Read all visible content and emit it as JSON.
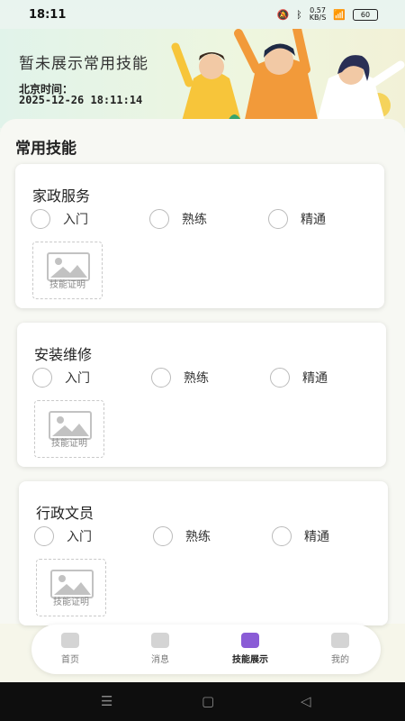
{
  "status_bar": {
    "time": "18:11",
    "net_speed_value": "0.57",
    "net_speed_unit": "KB/S",
    "battery": "60"
  },
  "header": {
    "title": "暂未展示常用技能",
    "time_label": "北京时间：",
    "time_value": "2025-12-26 18:11:14"
  },
  "section_title": "常用技能",
  "skill_levels": [
    "入门",
    "熟练",
    "精通"
  ],
  "cards": [
    {
      "title": "家政服务",
      "cert_label": "技能证明"
    },
    {
      "title": "安装维修",
      "cert_label": "技能证明"
    },
    {
      "title": "行政文员",
      "cert_label": "技能证明"
    }
  ],
  "bottom_nav": [
    {
      "label": "首页",
      "icon": "home-icon",
      "active": false
    },
    {
      "label": "消息",
      "icon": "message-icon",
      "active": false
    },
    {
      "label": "技能展示",
      "icon": "skills-icon",
      "active": true
    },
    {
      "label": "我的",
      "icon": "profile-icon",
      "active": false
    }
  ],
  "colors": {
    "accent": "#8a5cd6",
    "header_bg": "#e1f3ea"
  }
}
